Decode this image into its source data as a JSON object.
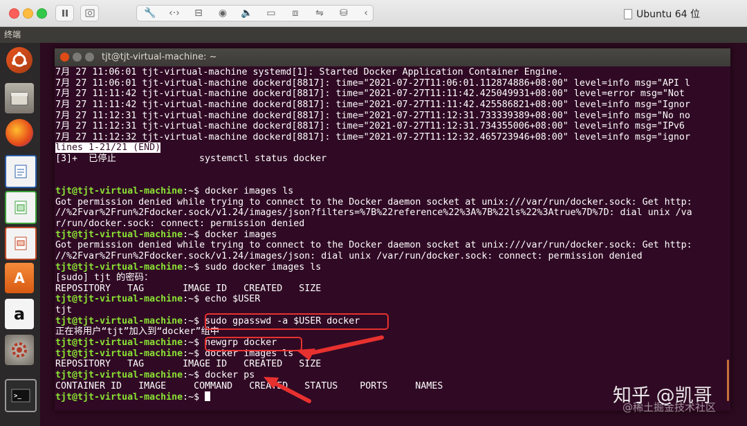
{
  "mac_toolbar": {
    "vm_name": "Ubuntu 64 位",
    "icons": [
      "pause-icon",
      "snapshot-icon",
      "settings-wrench-icon",
      "code-icon",
      "drive-icon",
      "camera-icon",
      "audio-icon",
      "video-icon",
      "display-icon",
      "usb-icon",
      "shared-folder-icon",
      "chevron-left-icon"
    ]
  },
  "ubuntu_panel": {
    "app_title": "终端"
  },
  "launcher": {
    "items": [
      "ubuntu-dash",
      "files",
      "firefox",
      "writer",
      "calc",
      "impress",
      "software-center",
      "amazon",
      "system-settings",
      "terminal"
    ]
  },
  "terminal": {
    "title": "tjt@tjt-virtual-machine: ~",
    "lines": [
      {
        "t": "out",
        "text": "7月 27 11:06:01 tjt-virtual-machine systemd[1]: Started Docker Application Container Engine."
      },
      {
        "t": "out",
        "text": "7月 27 11:06:01 tjt-virtual-machine dockerd[8817]: time=\"2021-07-27T11:06:01.112874886+08:00\" level=info msg=\"API l"
      },
      {
        "t": "out",
        "text": "7月 27 11:11:42 tjt-virtual-machine dockerd[8817]: time=\"2021-07-27T11:11:42.425049931+08:00\" level=error msg=\"Not"
      },
      {
        "t": "out",
        "text": "7月 27 11:11:42 tjt-virtual-machine dockerd[8817]: time=\"2021-07-27T11:11:42.425586821+08:00\" level=info msg=\"Ignor"
      },
      {
        "t": "out",
        "text": "7月 27 11:12:31 tjt-virtual-machine dockerd[8817]: time=\"2021-07-27T11:12:31.733339389+08:00\" level=info msg=\"No no"
      },
      {
        "t": "out",
        "text": "7月 27 11:12:31 tjt-virtual-machine dockerd[8817]: time=\"2021-07-27T11:12:31.734355006+08:00\" level=info msg=\"IPv6"
      },
      {
        "t": "out",
        "text": "7月 27 11:12:32 tjt-virtual-machine dockerd[8817]: time=\"2021-07-27T11:12:32.465723946+08:00\" level=info msg=\"ignor"
      },
      {
        "t": "inv",
        "text": "lines 1-21/21 (END)"
      },
      {
        "t": "out",
        "text": "[3]+  已停止               systemctl status docker"
      },
      {
        "t": "out",
        "text": ""
      },
      {
        "t": "out",
        "text": ""
      },
      {
        "t": "cmd",
        "prompt": "tjt@tjt-virtual-machine",
        "text": "docker images ls"
      },
      {
        "t": "out",
        "text": "Got permission denied while trying to connect to the Docker daemon socket at unix:///var/run/docker.sock: Get http:"
      },
      {
        "t": "out",
        "text": "//%2Fvar%2Frun%2Fdocker.sock/v1.24/images/json?filters=%7B%22reference%22%3A%7B%22ls%22%3Atrue%7D%7D: dial unix /va"
      },
      {
        "t": "out",
        "text": "r/run/docker.sock: connect: permission denied"
      },
      {
        "t": "cmd",
        "prompt": "tjt@tjt-virtual-machine",
        "text": "docker images"
      },
      {
        "t": "out",
        "text": "Got permission denied while trying to connect to the Docker daemon socket at unix:///var/run/docker.sock: Get http:"
      },
      {
        "t": "out",
        "text": "//%2Fvar%2Frun%2Fdocker.sock/v1.24/images/json: dial unix /var/run/docker.sock: connect: permission denied"
      },
      {
        "t": "cmd",
        "prompt": "tjt@tjt-virtual-machine",
        "text": "sudo docker images ls"
      },
      {
        "t": "out",
        "text": "[sudo] tjt 的密码："
      },
      {
        "t": "out",
        "text": "REPOSITORY   TAG       IMAGE ID   CREATED   SIZE"
      },
      {
        "t": "cmd",
        "prompt": "tjt@tjt-virtual-machine",
        "text": "echo $USER"
      },
      {
        "t": "out",
        "text": "tjt"
      },
      {
        "t": "cmd",
        "prompt": "tjt@tjt-virtual-machine",
        "text": "sudo gpasswd -a $USER docker"
      },
      {
        "t": "out",
        "text": "正在将用户“tjt”加入到“docker”组中"
      },
      {
        "t": "cmd",
        "prompt": "tjt@tjt-virtual-machine",
        "text": "newgrp docker"
      },
      {
        "t": "cmd",
        "prompt": "tjt@tjt-virtual-machine",
        "text": "docker images ls"
      },
      {
        "t": "out",
        "text": "REPOSITORY   TAG       IMAGE ID   CREATED   SIZE"
      },
      {
        "t": "cmd",
        "prompt": "tjt@tjt-virtual-machine",
        "text": "docker ps"
      },
      {
        "t": "out",
        "text": "CONTAINER ID   IMAGE     COMMAND   CREATED   STATUS    PORTS     NAMES"
      },
      {
        "t": "cmd",
        "prompt": "tjt@tjt-virtual-machine",
        "text": "",
        "cursor": true
      }
    ]
  },
  "watermark": {
    "main": "知乎 @凯哥",
    "sub": "@稀土掘金技术社区"
  },
  "colors": {
    "terminal_bg": "#300a24",
    "prompt": "#8ae234",
    "highlight": "#e8312f"
  }
}
